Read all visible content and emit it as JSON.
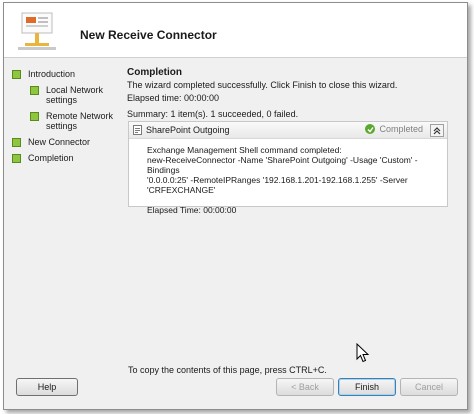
{
  "window": {
    "title": "New Receive Connector"
  },
  "steps": [
    {
      "label": "Introduction"
    },
    {
      "label": "Local Network settings"
    },
    {
      "label": "Remote Network settings"
    },
    {
      "label": "New Connector"
    },
    {
      "label": "Completion"
    }
  ],
  "completion": {
    "heading": "Completion",
    "message": "The wizard completed successfully. Click Finish to close this wizard.",
    "elapsed": "Elapsed time: 00:00:00",
    "summary": "Summary: 1 item(s). 1 succeeded, 0 failed."
  },
  "result": {
    "name": "SharePoint Outgoing",
    "status": "Completed",
    "body_lines": [
      "Exchange Management Shell command completed:",
      "new-ReceiveConnector -Name 'SharePoint Outgoing' -Usage 'Custom' -Bindings",
      "'0.0.0.0:25' -RemoteIPRanges '192.168.1.201-192.168.1.255' -Server",
      "'CRFEXCHANGE'"
    ],
    "elapsed": "Elapsed Time: 00:00:00"
  },
  "footer": {
    "copy_hint": "To copy the contents of this page, press CTRL+C.",
    "help_label": "Help",
    "back_label": "< Back",
    "finish_label": "Finish",
    "cancel_label": "Cancel"
  },
  "colors": {
    "step_marker": "#8fc640",
    "completed_check": "#5ca830",
    "default_button_border": "#3c7fb1"
  }
}
